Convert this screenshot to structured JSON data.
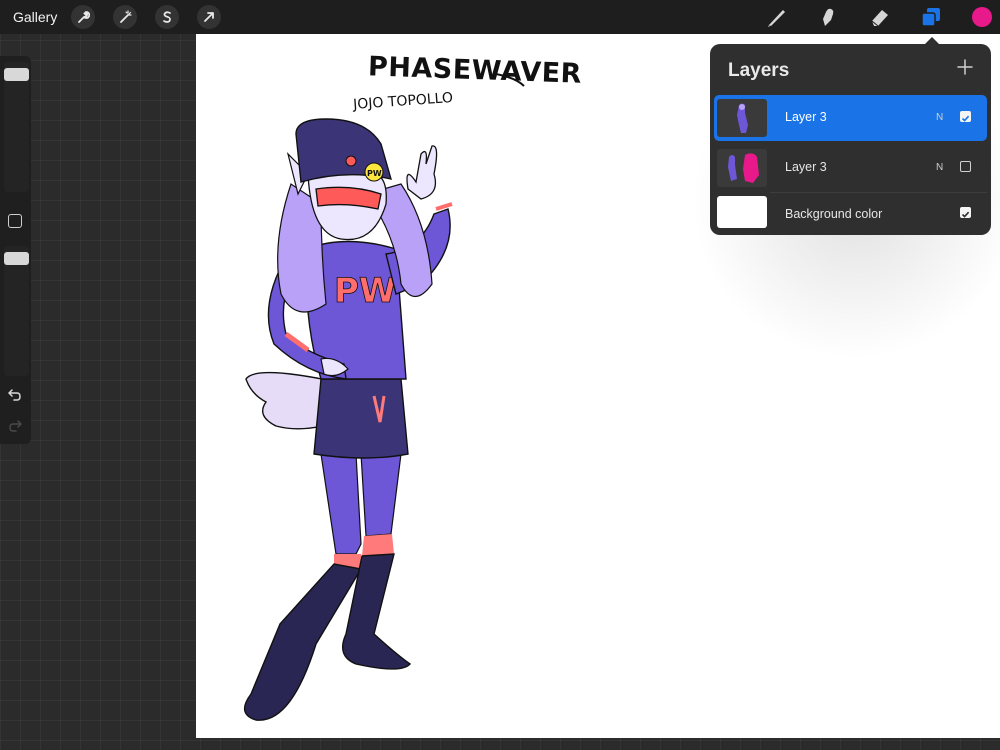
{
  "toolbar": {
    "gallery_label": "Gallery",
    "left_tools": [
      "wrench-icon",
      "magic-wand-icon",
      "selection-s-icon",
      "transform-arrow-icon"
    ],
    "right_tools": [
      "brush-icon",
      "smudge-icon",
      "eraser-icon",
      "layers-icon",
      "color-swatch"
    ],
    "active_color": "#e8198b",
    "accent": "#1a74e8"
  },
  "sidebar": {
    "brush_size_level": 0.9,
    "opacity_level": 0.9,
    "controls": [
      "modify-button",
      "undo-icon",
      "redo-icon"
    ]
  },
  "canvas": {
    "title_text": "PHASEWAVER",
    "subtitle_text": "JOJO TOPOLLO"
  },
  "layers_panel": {
    "title": "Layers",
    "add_icon": "plus-icon",
    "layers": [
      {
        "name": "Layer 3",
        "blend": "N",
        "visible": true,
        "selected": true
      },
      {
        "name": "Layer 3",
        "blend": "N",
        "visible": false,
        "selected": false
      },
      {
        "name": "Background color",
        "visible": true,
        "selected": false
      }
    ]
  }
}
